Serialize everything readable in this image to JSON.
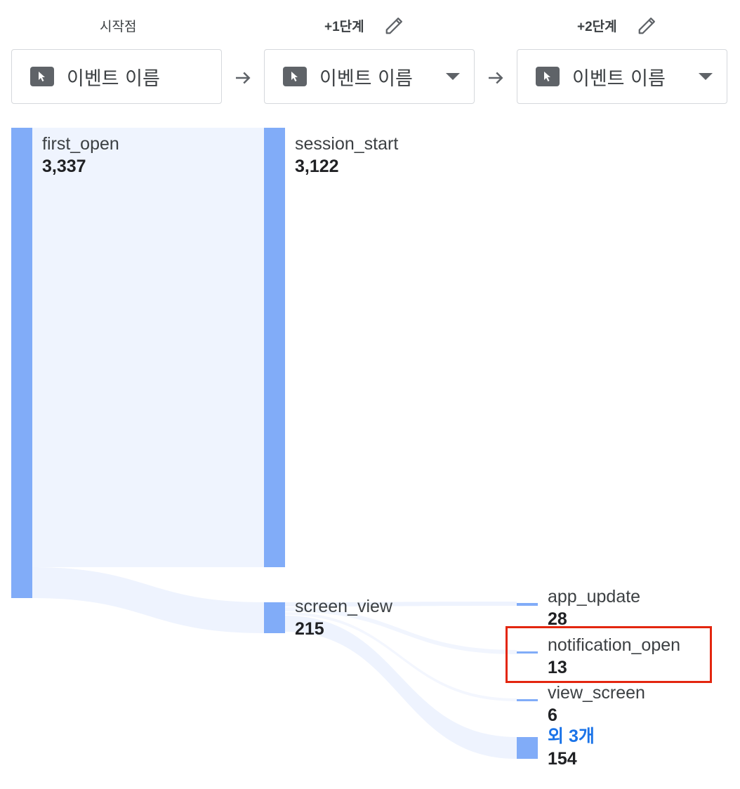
{
  "columns": [
    {
      "title": "시작점",
      "editable": false,
      "selector_label": "이벤트 이름",
      "has_dropdown": false
    },
    {
      "title": "+1단계",
      "editable": true,
      "selector_label": "이벤트 이름",
      "has_dropdown": true
    },
    {
      "title": "+2단계",
      "editable": true,
      "selector_label": "이벤트 이름",
      "has_dropdown": true
    }
  ],
  "nodes": {
    "first_open": {
      "name": "first_open",
      "value": "3,337"
    },
    "session_start": {
      "name": "session_start",
      "value": "3,122"
    },
    "screen_view": {
      "name": "screen_view",
      "value": "215"
    },
    "app_update": {
      "name": "app_update",
      "value": "28"
    },
    "notification_open": {
      "name": "notification_open",
      "value": "13"
    },
    "view_screen": {
      "name": "view_screen",
      "value": "6"
    },
    "others": {
      "name": "외 3개",
      "value": "154"
    }
  },
  "colors": {
    "bar": "#81acf8",
    "flow": "#eef3fe",
    "highlight": "#e3260f",
    "link": "#1a73e8"
  },
  "icons": [
    "pencil-icon",
    "cursor-icon",
    "dropdown-icon",
    "arrow-right-icon"
  ]
}
